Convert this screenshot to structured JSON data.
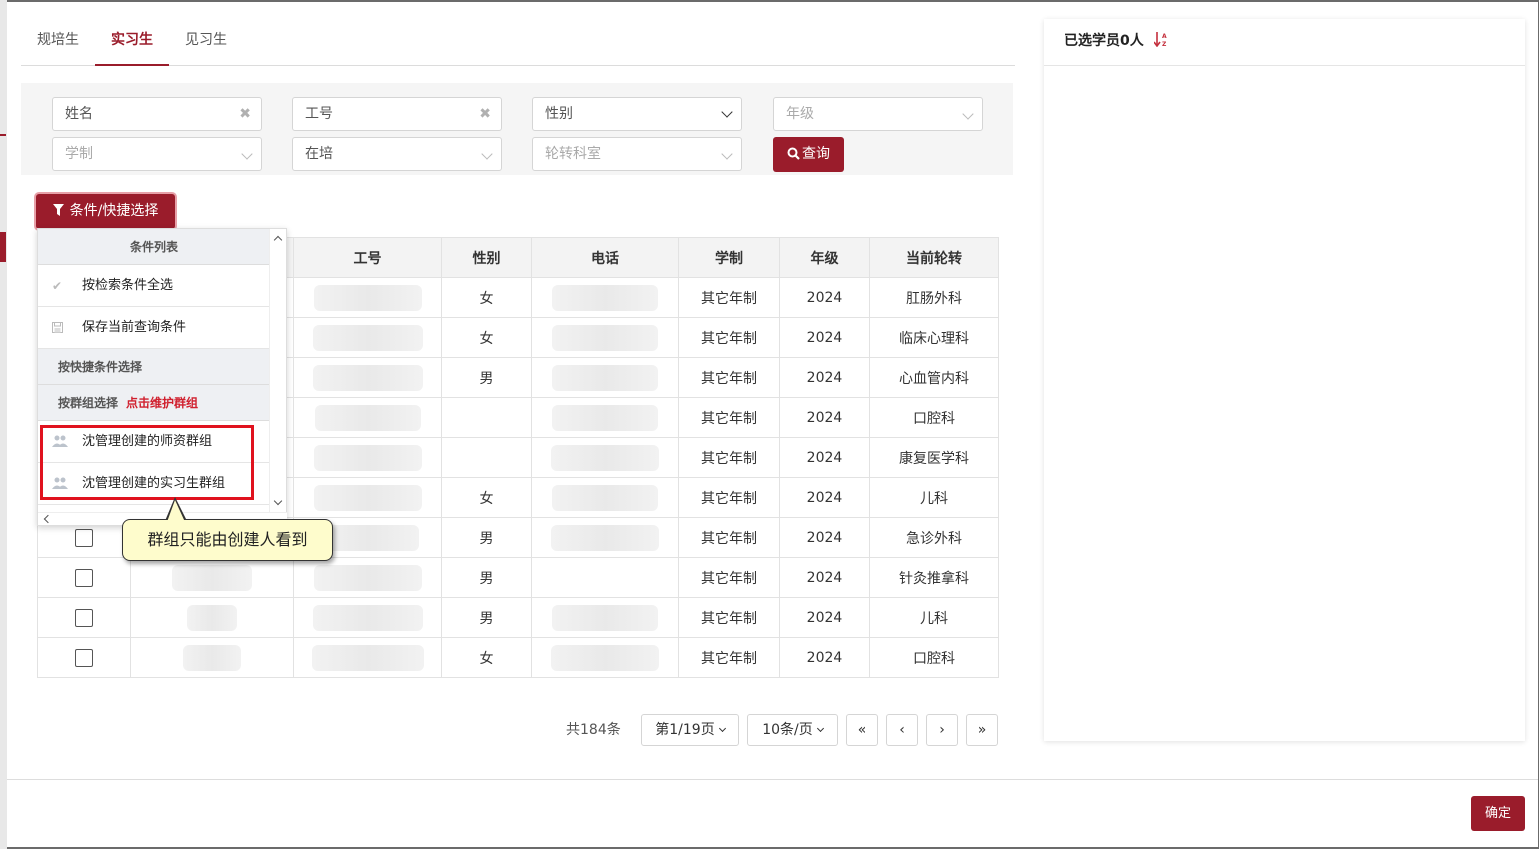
{
  "tabs": [
    "规培生",
    "实习生",
    "见习生"
  ],
  "active_tab": 1,
  "filters": {
    "name_placeholder": "姓名",
    "id_placeholder": "工号",
    "gender_value": "性别",
    "grade_placeholder": "年级",
    "system_placeholder": "学制",
    "status_value": "在培",
    "dept_placeholder": "轮转科室",
    "clear_symbol": "✖",
    "query_label": "查询"
  },
  "cond_button_label": "条件/快捷选择",
  "dropdown": {
    "header": "条件列表",
    "select_all": "按检索条件全选",
    "save_query": "保存当前查询条件",
    "quick_select": "按快捷条件选择",
    "group_select": "按群组选择",
    "maintain_link": "点击维护群组",
    "groups": [
      "沈管理创建的师资群组",
      "沈管理创建的实习生群组"
    ]
  },
  "callout_text": "群组只能由创建人看到",
  "table": {
    "headers": [
      "",
      "",
      "工号",
      "性别",
      "电话",
      "学制",
      "年级",
      "当前轮转"
    ],
    "rows": [
      {
        "gender": "女",
        "system": "其它年制",
        "grade": "2024",
        "dept": "肛肠外科"
      },
      {
        "gender": "女",
        "system": "其它年制",
        "grade": "2024",
        "dept": "临床心理科"
      },
      {
        "gender": "男",
        "system": "其它年制",
        "grade": "2024",
        "dept": "心血管内科"
      },
      {
        "gender": "",
        "system": "其它年制",
        "grade": "2024",
        "dept": "口腔科"
      },
      {
        "gender": "",
        "system": "其它年制",
        "grade": "2024",
        "dept": "康复医学科"
      },
      {
        "gender": "女",
        "system": "其它年制",
        "grade": "2024",
        "dept": "儿科"
      },
      {
        "gender": "男",
        "system": "其它年制",
        "grade": "2024",
        "dept": "急诊外科"
      },
      {
        "gender": "男",
        "system": "其它年制",
        "grade": "2024",
        "dept": "针灸推拿科"
      },
      {
        "gender": "男",
        "system": "其它年制",
        "grade": "2024",
        "dept": "儿科"
      },
      {
        "gender": "女",
        "system": "其它年制",
        "grade": "2024",
        "dept": "口腔科"
      }
    ]
  },
  "pagination": {
    "total": "共184条",
    "page": "第1/19页",
    "size": "10条/页",
    "first": "«",
    "prev": "‹",
    "next": "›",
    "last": "»"
  },
  "right_panel": {
    "title": "已选学员0人"
  },
  "confirm_label": "确定",
  "colors": {
    "accent": "#9a1c2b",
    "highlight": "#e0121e",
    "callout_bg": "#fefccc"
  }
}
